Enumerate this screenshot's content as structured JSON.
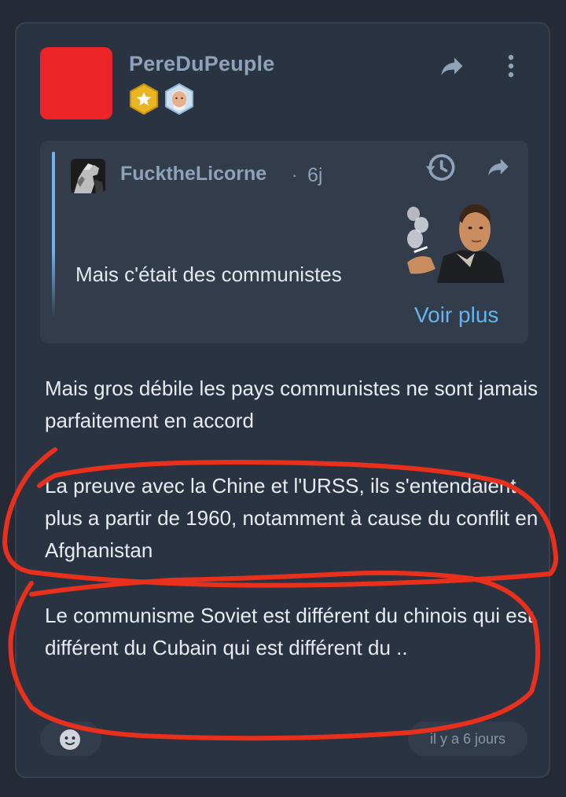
{
  "post": {
    "author": "PereDuPeuple",
    "avatar_color": "#ec2327",
    "badges": [
      "gold-star-badge",
      "face-avatar-badge"
    ]
  },
  "quote": {
    "author": "FucktheLicorne",
    "separator": "·",
    "time": "6j",
    "text": "Mais c'était des communistes",
    "see_more": "Voir plus",
    "accent_color": "#6fb2ee"
  },
  "body": {
    "paragraphs": [
      "Mais gros débile les pays communistes ne sont jamais parfaitement en accord",
      "La preuve avec la Chine et l'URSS, ils s'entendaient plus a partir de 1960, notamment à cause du conflit en Afghanistan",
      "Le communisme Soviet est différent du chinois qui est différent du Cubain qui est différent du .."
    ]
  },
  "footer": {
    "timestamp": "il y a 6 jours"
  },
  "icons": {
    "share": "share-icon",
    "more": "more-vertical-icon",
    "history": "history-icon",
    "reaction": "smiley-icon"
  },
  "colors": {
    "background": "#242b37",
    "card": "#2a3341",
    "link": "#64b4ef",
    "annotation": "#e8301c"
  }
}
